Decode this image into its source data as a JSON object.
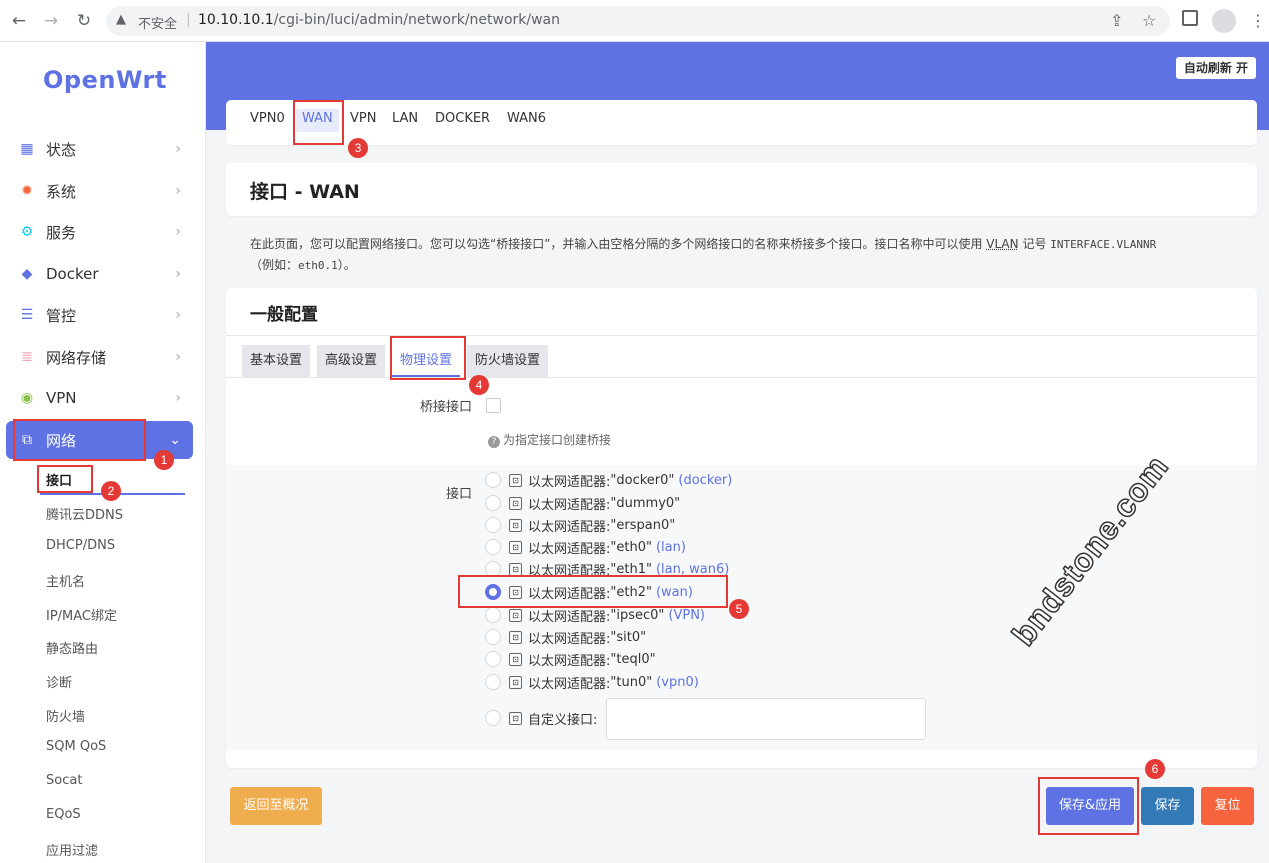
{
  "browser": {
    "insecure_label": "不安全",
    "url_host": "10.10.10.1",
    "url_path": "/cgi-bin/luci/admin/network/network/wan"
  },
  "sidebar": {
    "logo": "OpenWrt",
    "items": [
      {
        "label": "状态",
        "icon": "dashboard-icon"
      },
      {
        "label": "系统",
        "icon": "gear-icon"
      },
      {
        "label": "服务",
        "icon": "services-icon"
      },
      {
        "label": "Docker",
        "icon": "docker-icon"
      },
      {
        "label": "管控",
        "icon": "sliders-icon"
      },
      {
        "label": "网络存储",
        "icon": "database-icon"
      },
      {
        "label": "VPN",
        "icon": "vpn-icon"
      },
      {
        "label": "网络",
        "icon": "network-icon"
      }
    ],
    "sub_items": [
      "接口",
      "腾讯云DDNS",
      "DHCP/DNS",
      "主机名",
      "IP/MAC绑定",
      "静态路由",
      "诊断",
      "防火墙",
      "SQM QoS",
      "Socat",
      "EQoS",
      "应用过滤"
    ]
  },
  "header": {
    "auto_refresh": "自动刷新 开"
  },
  "iface_tabs": [
    "VPN0",
    "WAN",
    "VPN",
    "LAN",
    "DOCKER",
    "WAN6"
  ],
  "page": {
    "title": "接口 - WAN",
    "desc_1": "在此页面，您可以配置网络接口。您可以勾选“桥接接口”，并输入由空格分隔的多个网络接口的名称来桥接多个接口。接口名称中可以使用 ",
    "desc_vlan": "VLAN",
    "desc_2": " 记号 ",
    "desc_code": "INTERFACE.VLANNR",
    "desc_3": "（例如：",
    "desc_example": "eth0.1",
    "desc_4": "）。"
  },
  "config": {
    "section_title": "一般配置",
    "tabs": [
      "基本设置",
      "高级设置",
      "物理设置",
      "防火墙设置"
    ],
    "bridge_label": "桥接接口",
    "bridge_hint": "为指定接口创建桥接",
    "iface_label": "接口",
    "adapter_prefix": "以太网适配器: ",
    "interfaces": [
      {
        "name": "\"docker0\"",
        "net": "(docker)"
      },
      {
        "name": "\"dummy0\"",
        "net": ""
      },
      {
        "name": "\"erspan0\"",
        "net": ""
      },
      {
        "name": "\"eth0\"",
        "net": "(lan)"
      },
      {
        "name": "\"eth1\"",
        "net": "(lan, wan6)"
      },
      {
        "name": "\"eth2\"",
        "net": "(wan)"
      },
      {
        "name": "\"ipsec0\"",
        "net": "(VPN)"
      },
      {
        "name": "\"sit0\"",
        "net": ""
      },
      {
        "name": "\"teql0\"",
        "net": ""
      },
      {
        "name": "\"tun0\"",
        "net": "(vpn0)"
      }
    ],
    "custom_label": "自定义接口:"
  },
  "buttons": {
    "back": "返回至概况",
    "save_apply": "保存&应用",
    "save": "保存",
    "reset": "复位"
  },
  "annotations": [
    "1",
    "2",
    "3",
    "4",
    "5",
    "6"
  ],
  "watermark": "bndstone.com",
  "colors": {
    "accent": "#5e72e4",
    "back_button": "#f0ad4e",
    "save_button": "#337ab7",
    "reset_button": "#f5643c",
    "annotation": "#e53935"
  }
}
